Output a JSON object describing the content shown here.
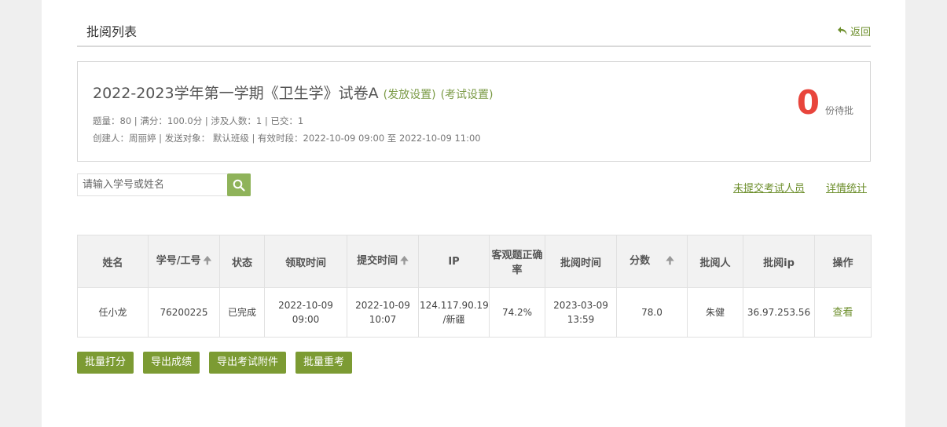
{
  "header": {
    "title": "批阅列表",
    "back_label": "返回"
  },
  "exam": {
    "title": "2022-2023学年第一学期《卫生学》试卷A",
    "release_settings": "(发放设置)",
    "exam_settings": "(考试设置)",
    "meta_line1": "题量：80 |  满分：100.0分 |  涉及人数：1 | 已交：1",
    "meta_line2": "创建人：周丽婷 | 发送对象：  默认班级  |  有效时段：2022-10-09 09:00 至 2022-10-09 11:00",
    "pending_count": "0",
    "pending_label": "份待批"
  },
  "search": {
    "placeholder": "请输入学号或姓名",
    "value": ""
  },
  "links": {
    "not_submitted": "未提交考试人员",
    "detail_stats": "详情统计"
  },
  "table": {
    "headers": {
      "name": "姓名",
      "id": "学号/工号",
      "status": "状态",
      "receive_time": "领取时间",
      "submit_time": "提交时间",
      "ip": "IP",
      "objective_rate": "客观题正确率",
      "review_time": "批阅时间",
      "score": "分数",
      "reviewer": "批阅人",
      "review_ip": "批阅ip",
      "action": "操作"
    },
    "rows": [
      {
        "name": "任小龙",
        "id": "76200225",
        "status": "已完成",
        "receive_date": "2022-10-09",
        "receive_clock": "09:00",
        "submit_date": "2022-10-09",
        "submit_clock": "10:07",
        "ip": "124.117.90.19",
        "ip_region": "/新疆",
        "objective_rate": "74.2%",
        "review_date": "2023-03-09",
        "review_clock": "13:59",
        "score": "78.0",
        "reviewer": "朱健",
        "review_ip": "36.97.253.56",
        "action": "查看"
      }
    ]
  },
  "buttons": {
    "batch_score": "批量打分",
    "export_scores": "导出成绩",
    "export_attachments": "导出考试附件",
    "batch_retake": "批量重考"
  },
  "colors": {
    "accent": "#7c9b33",
    "pending": "#e8453c",
    "link": "#6c8e2b"
  },
  "icons": {
    "back": "back-arrow-icon",
    "search": "search-icon",
    "sort": "sort-up-icon"
  }
}
